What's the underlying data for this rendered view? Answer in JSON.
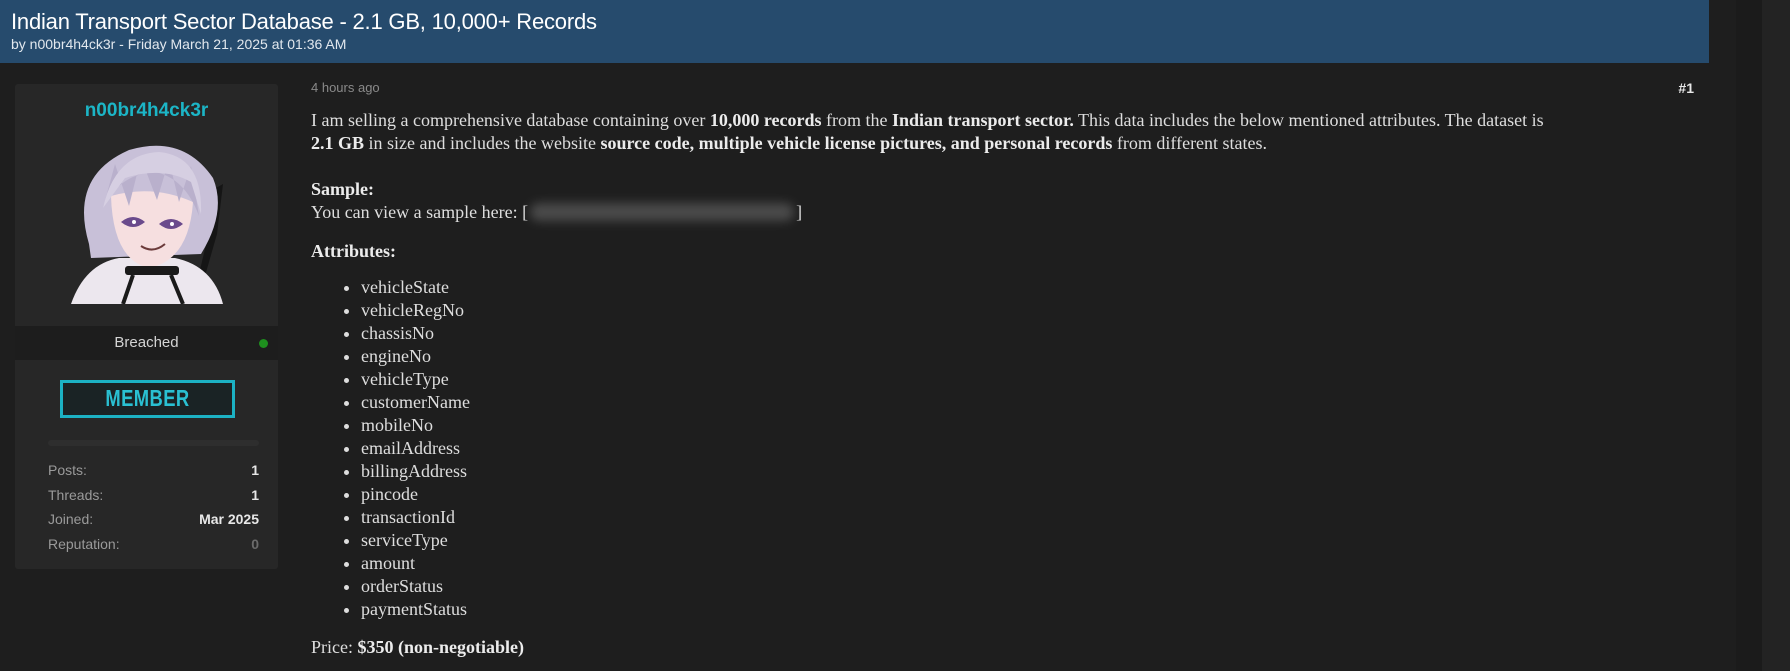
{
  "thread": {
    "title": "Indian Transport Sector Database - 2.1 GB, 10,000+ Records",
    "meta": "by n00br4h4ck3r - Friday March 21, 2025 at 01:36 AM"
  },
  "user": {
    "username": "n00br4h4ck3r",
    "avatar_icon": "anime-avatar-icon",
    "rank": "Breached",
    "online_status": "online",
    "badge": "MEMBER",
    "stats": [
      {
        "label": "Posts:",
        "value": "1"
      },
      {
        "label": "Threads:",
        "value": "1"
      },
      {
        "label": "Joined:",
        "value": "Mar 2025"
      },
      {
        "label": "Reputation:",
        "value": "0"
      }
    ]
  },
  "post": {
    "time": "4 hours ago",
    "number": "#1",
    "intro": {
      "t1": "I am selling a comprehensive database containing over ",
      "b1": "10,000 records",
      "t2": " from the ",
      "b2": "Indian transport sector.",
      "t3": " This data includes the below mentioned attributes. The dataset is ",
      "b3": "2.1 GB",
      "t4": " in size and includes the website ",
      "b4": "source code, multiple vehicle license pictures, and personal records",
      "t5": " from different states."
    },
    "sample_heading": "Sample:",
    "sample_text": "You can view a sample here: [",
    "sample_close": "]",
    "attributes_heading": "Attributes:",
    "attributes": [
      "vehicleState",
      "vehicleRegNo",
      "chassisNo",
      "engineNo",
      "vehicleType",
      "customerName",
      "mobileNo",
      "emailAddress",
      "billingAddress",
      "pincode",
      "transactionId",
      "serviceType",
      "amount",
      "orderStatus",
      "paymentStatus"
    ],
    "price_label": "Price: ",
    "price_value": "$350 (non-negotiable)"
  },
  "colors": {
    "header_bg": "#264b6d",
    "accent": "#1cb5c6",
    "online": "#1e8f1e",
    "page_bg": "#1e1e1e",
    "panel_bg": "#272727"
  }
}
